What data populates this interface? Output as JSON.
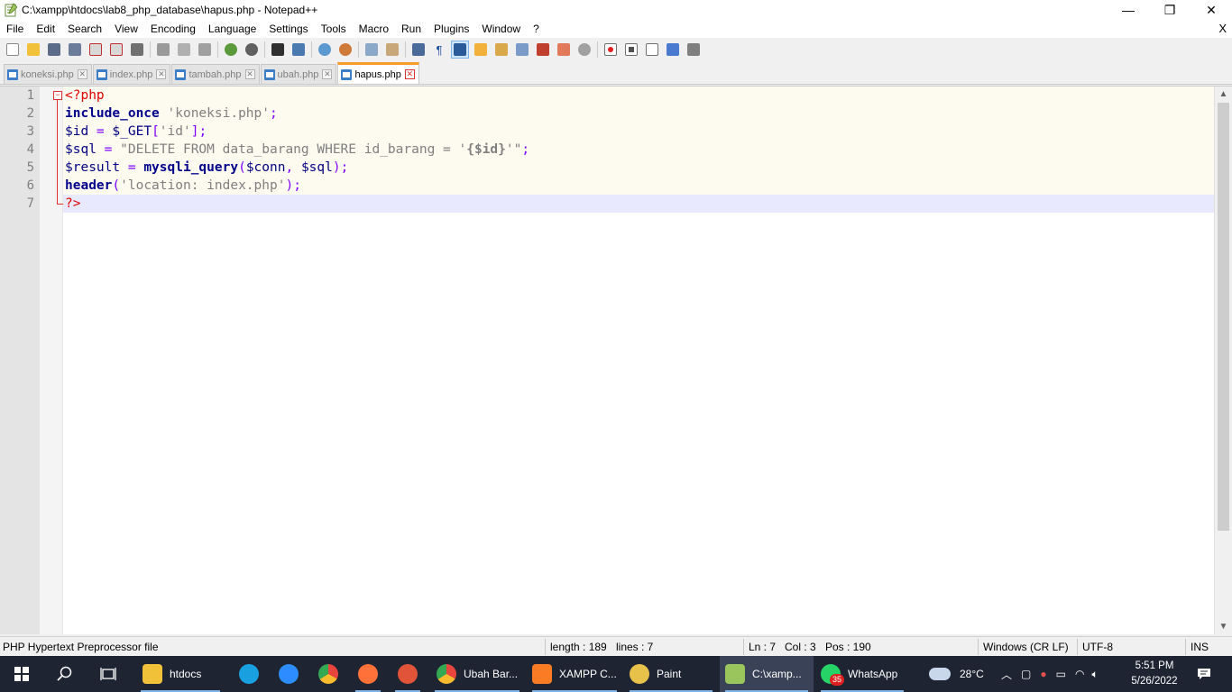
{
  "window": {
    "title": "C:\\xampp\\htdocs\\lab8_php_database\\hapus.php - Notepad++",
    "minimize": "—",
    "restore": "❐",
    "close": "✕"
  },
  "menu": {
    "items": [
      "File",
      "Edit",
      "Search",
      "View",
      "Encoding",
      "Language",
      "Settings",
      "Tools",
      "Macro",
      "Run",
      "Plugins",
      "Window",
      "?"
    ],
    "close_doc": "X"
  },
  "tabs": [
    {
      "label": "koneksi.php",
      "active": false
    },
    {
      "label": "index.php",
      "active": false
    },
    {
      "label": "tambah.php",
      "active": false
    },
    {
      "label": "ubah.php",
      "active": false
    },
    {
      "label": "hapus.php",
      "active": true
    }
  ],
  "editor": {
    "line_numbers": [
      "1",
      "2",
      "3",
      "4",
      "5",
      "6",
      "7"
    ],
    "current_line": 7,
    "code": {
      "l1_open": "<?php",
      "l2_fn": "include_once",
      "l2_sp": " ",
      "l2_str": "'koneksi.php'",
      "l2_end": ";",
      "l3_var": "$id",
      "l3_op": " = ",
      "l3_get": "$_GET",
      "l3_br1": "[",
      "l3_str": "'id'",
      "l3_br2": "]",
      "l3_end": ";",
      "l4_var": "$sql",
      "l4_op": " = ",
      "l4_str1": "\"DELETE FROM data_barang WHERE id_barang = '",
      "l4_strvar": "{$id}",
      "l4_str2": "'\"",
      "l4_end": ";",
      "l5_var": "$result",
      "l5_op": " = ",
      "l5_fn": "mysqli_query",
      "l5_p1": "(",
      "l5_a1": "$conn",
      "l5_c": ", ",
      "l5_a2": "$sql",
      "l5_p2": ")",
      "l5_end": ";",
      "l6_fn": "header",
      "l6_p1": "(",
      "l6_str": "'location: index.php'",
      "l6_p2": ")",
      "l6_end": ";",
      "l7_close": "?>"
    }
  },
  "status": {
    "file_type": "PHP Hypertext Preprocessor file",
    "length": "length : 189",
    "lines": "lines : 7",
    "ln": "Ln : 7",
    "col": "Col : 3",
    "pos": "Pos : 190",
    "eol": "Windows (CR LF)",
    "encoding": "UTF-8",
    "mode": "INS"
  },
  "taskbar": {
    "items": [
      {
        "label": "htdocs",
        "color": "#f2c13a"
      },
      {
        "label": "",
        "color": "#1aa0e0"
      },
      {
        "label": "",
        "color": "#2d8cff"
      },
      {
        "label": "",
        "color": "#e8453c"
      },
      {
        "label": "",
        "color": "#ff7139"
      },
      {
        "label": "",
        "color": "#e2543a"
      },
      {
        "label": "Ubah Bar...",
        "color": "#34a853"
      },
      {
        "label": "XAMPP C...",
        "color": "#fb7a24"
      },
      {
        "label": "Paint",
        "color": "#e8c14a"
      },
      {
        "label": "C:\\xamp...",
        "color": "#9ac45c"
      },
      {
        "label": "WhatsApp",
        "color": "#25d366"
      }
    ],
    "whatsapp_badge": "35",
    "weather": "28°C",
    "time": "5:51 PM",
    "date": "5/26/2022",
    "colors": {
      "bg": "#1f2433",
      "accent": "#fa9a28"
    }
  }
}
